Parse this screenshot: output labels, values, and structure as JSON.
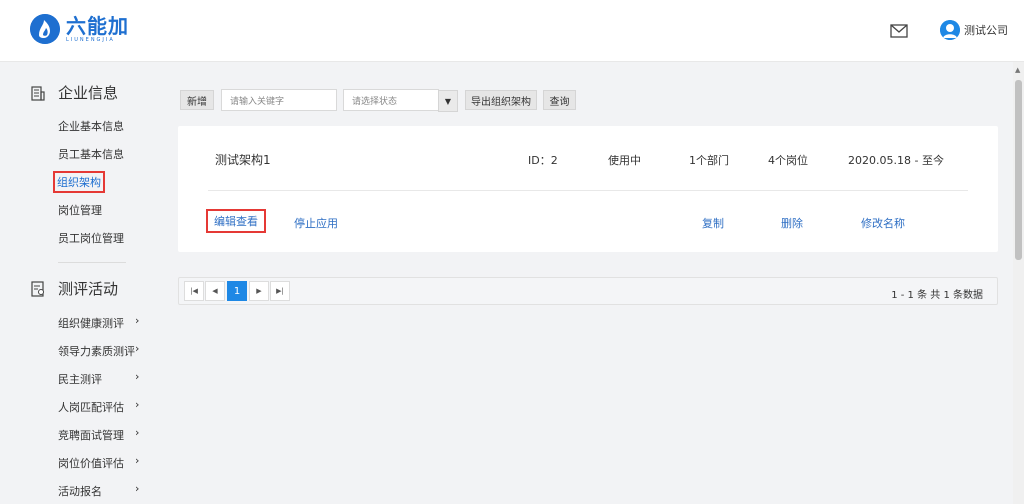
{
  "header": {
    "logo_cn": "六能加",
    "logo_en": "LIUNENGJIA",
    "company": "测试公司"
  },
  "sidebar": {
    "sections": [
      {
        "title": "企业信息",
        "items": [
          "企业基本信息",
          "员工基本信息",
          "组织架构",
          "岗位管理",
          "员工岗位管理"
        ],
        "active": "组织架构"
      },
      {
        "title": "测评活动",
        "items": [
          "组织健康测评",
          "领导力素质测评",
          "民主测评",
          "人岗匹配评估",
          "竞聘面试管理",
          "岗位价值评估",
          "活动报名"
        ]
      }
    ]
  },
  "toolbar": {
    "add_label": "新增",
    "keyword_placeholder": "请输入关键字",
    "status_placeholder": "请选择状态",
    "export_label": "导出组织架构",
    "query_label": "查询"
  },
  "card": {
    "name": "测试架构1",
    "id": "ID：2",
    "status": "使用中",
    "departments": "1个部门",
    "positions": "4个岗位",
    "period": "2020.05.18 - 至今",
    "actions": {
      "edit_view": "编辑查看",
      "stop": "停止应用",
      "copy": "复制",
      "delete": "删除",
      "rename": "修改名称"
    }
  },
  "pagination": {
    "current_page": "1",
    "info": "1 - 1 条   共 1 条数据"
  },
  "colors": {
    "brand": "#1e6fd0",
    "link": "#2f6fc4",
    "highlight": "#e53935",
    "page_active": "#1e88e5"
  }
}
